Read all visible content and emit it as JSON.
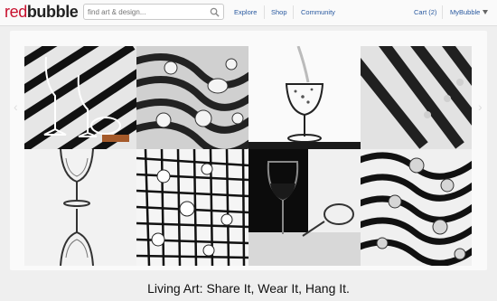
{
  "logo": {
    "part1": "red",
    "part2": "bubble"
  },
  "search": {
    "placeholder": "find art & design..."
  },
  "nav": {
    "explore": "Explore",
    "shop": "Shop",
    "community": "Community",
    "cart": "Cart (2)",
    "mybubble": "MyBubble"
  },
  "caption": "Living Art: Share It, Wear It, Hang It.",
  "colors": {
    "brand": "#c8102e",
    "link": "#2a5aa0"
  },
  "icons": {
    "search": "search-icon",
    "menu": "chevron-down-icon"
  }
}
